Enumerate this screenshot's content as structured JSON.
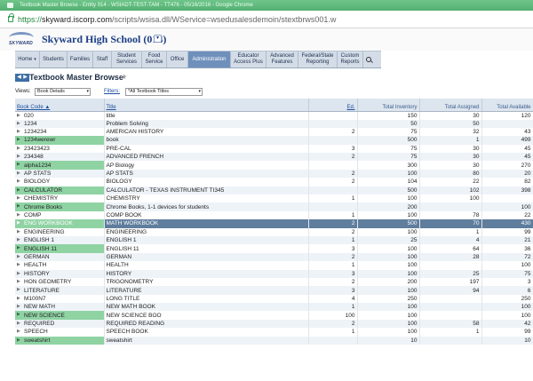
{
  "window": {
    "title": "Textbook Master Browse - Entity 014 - WSIADT-TEST-TAM - TT476 - 05/16/2016 - Google Chrome"
  },
  "address": {
    "scheme": "https://",
    "host": "skyward.iscorp.com",
    "path": "/scripts/wsisa.dll/WService=wsedusalesdemoin/stextbrws001.w"
  },
  "app": {
    "logo_text": "SKYWARD",
    "school_name": "Skyward High School (014)"
  },
  "nav": [
    {
      "label": "Home",
      "has_dropdown": true
    },
    {
      "label": "Students"
    },
    {
      "label": "Families"
    },
    {
      "label": "Staff"
    },
    {
      "label": "Student Services"
    },
    {
      "label": "Food Service"
    },
    {
      "label": "Office"
    },
    {
      "label": "Administration",
      "active": true
    },
    {
      "label": "Educator Access Plus"
    },
    {
      "label": "Advanced Features"
    },
    {
      "label": "Federal/State Reporting"
    },
    {
      "label": "Custom Reports"
    }
  ],
  "page": {
    "title": "Textbook Master Browse"
  },
  "toolbar": {
    "views_label": "Views:",
    "views_value": "Book Details",
    "filters_label": "Filters:",
    "filters_value": "*All Textbook Titles"
  },
  "table": {
    "columns": {
      "code": "Book Code ▲",
      "title": "Title",
      "edition": "Ed.",
      "inventory": "Total Inventory",
      "assigned": "Total Assigned",
      "available": "Total Available"
    },
    "rows": [
      {
        "code": "020",
        "title": "title",
        "ed": "",
        "inv": "150",
        "asg": "30",
        "avl": "120"
      },
      {
        "code": "1234",
        "title": "Problem Solving",
        "ed": "",
        "inv": "50",
        "asg": "50",
        "avl": ""
      },
      {
        "code": "1234234",
        "title": "AMERICAN HISTORY",
        "ed": "2",
        "inv": "75",
        "asg": "32",
        "avl": "43"
      },
      {
        "code": "1234werewr",
        "title": "book",
        "ed": "",
        "inv": "500",
        "asg": "1",
        "avl": "499",
        "hl": true
      },
      {
        "code": "23423423",
        "title": "PRE-CAL",
        "ed": "3",
        "inv": "75",
        "asg": "30",
        "avl": "45"
      },
      {
        "code": "234348",
        "title": "ADVANCED FRENCH",
        "ed": "2",
        "inv": "75",
        "asg": "30",
        "avl": "45"
      },
      {
        "code": "alpha1234",
        "title": "AP Biology",
        "ed": "",
        "inv": "300",
        "asg": "30",
        "avl": "270",
        "hl": true
      },
      {
        "code": "AP STATS",
        "title": "AP STATS",
        "ed": "2",
        "inv": "100",
        "asg": "80",
        "avl": "20"
      },
      {
        "code": "BIOLOGY",
        "title": "BIOLOGY",
        "ed": "2",
        "inv": "104",
        "asg": "22",
        "avl": "82"
      },
      {
        "code": "CALCULATOR",
        "title": "CALCULATOR - TEXAS INSTRUMENT TI345",
        "ed": "",
        "inv": "500",
        "asg": "102",
        "avl": "398",
        "hl": true
      },
      {
        "code": "CHEMISTRY",
        "title": "CHEMISTRY",
        "ed": "1",
        "inv": "100",
        "asg": "100",
        "avl": ""
      },
      {
        "code": "Chrome Books",
        "title": "Chrome Books, 1-1 devices for students",
        "ed": "",
        "inv": "200",
        "asg": "",
        "avl": "100",
        "hl": true
      },
      {
        "code": "COMP",
        "title": "COMP BOOK",
        "ed": "1",
        "inv": "100",
        "asg": "78",
        "avl": "22"
      },
      {
        "code": "ENG WORKBOOK",
        "title": "MATH WORKBOOK",
        "ed": "2",
        "inv": "500",
        "asg": "70",
        "avl": "430",
        "hl": true,
        "selected": true
      },
      {
        "code": "ENGINEERING",
        "title": "ENGINEERING",
        "ed": "2",
        "inv": "100",
        "asg": "1",
        "avl": "99"
      },
      {
        "code": "ENGLISH 1",
        "title": "ENGLISH 1",
        "ed": "1",
        "inv": "25",
        "asg": "4",
        "avl": "21"
      },
      {
        "code": "ENGLISH 11",
        "title": "ENGLISH 11",
        "ed": "3",
        "inv": "100",
        "asg": "64",
        "avl": "36",
        "hl": true
      },
      {
        "code": "GERMAN",
        "title": "GERMAN",
        "ed": "2",
        "inv": "100",
        "asg": "28",
        "avl": "72"
      },
      {
        "code": "HEALTH",
        "title": "HEALTH",
        "ed": "1",
        "inv": "100",
        "asg": "",
        "avl": "100"
      },
      {
        "code": "HISTORY",
        "title": "HISTORY",
        "ed": "3",
        "inv": "100",
        "asg": "25",
        "avl": "75"
      },
      {
        "code": "HON GEOMETRY",
        "title": "TRIGONOMETRY",
        "ed": "2",
        "inv": "200",
        "asg": "197",
        "avl": "3"
      },
      {
        "code": "LITERATURE",
        "title": "LITERATURE",
        "ed": "3",
        "inv": "100",
        "asg": "94",
        "avl": "6"
      },
      {
        "code": "M100N7",
        "title": "LONG TITLE",
        "ed": "4",
        "inv": "250",
        "asg": "",
        "avl": "250"
      },
      {
        "code": "NEW MATH",
        "title": "NEW MATH BOOK",
        "ed": "1",
        "inv": "100",
        "asg": "",
        "avl": "100"
      },
      {
        "code": "NEW SCIENCE",
        "title": "NEW SCIENCE BOO",
        "ed": "100",
        "inv": "100",
        "asg": "",
        "avl": "100",
        "hl": true
      },
      {
        "code": "REQUIRED",
        "title": "REQUIRED READING",
        "ed": "2",
        "inv": "100",
        "asg": "58",
        "avl": "42"
      },
      {
        "code": "SPEECH",
        "title": "SPEECH BOOK",
        "ed": "1",
        "inv": "100",
        "asg": "1",
        "avl": "99"
      },
      {
        "code": "sweatshirt",
        "title": "sweatshirt",
        "ed": "",
        "inv": "10",
        "asg": "",
        "avl": "10",
        "hl": true
      }
    ]
  },
  "icons": {
    "lock": "lock-icon",
    "search": "search-icon",
    "back": "arrow-left-icon",
    "forward": "arrow-right-icon",
    "favorite": "star-icon",
    "expand": "expand-arrow-icon"
  },
  "colors": {
    "active_nav": "#6f90bb",
    "selected_row": "#5f7d9d",
    "highlight_code": "#8fd3a3",
    "title_bar": "#5cb87a"
  }
}
